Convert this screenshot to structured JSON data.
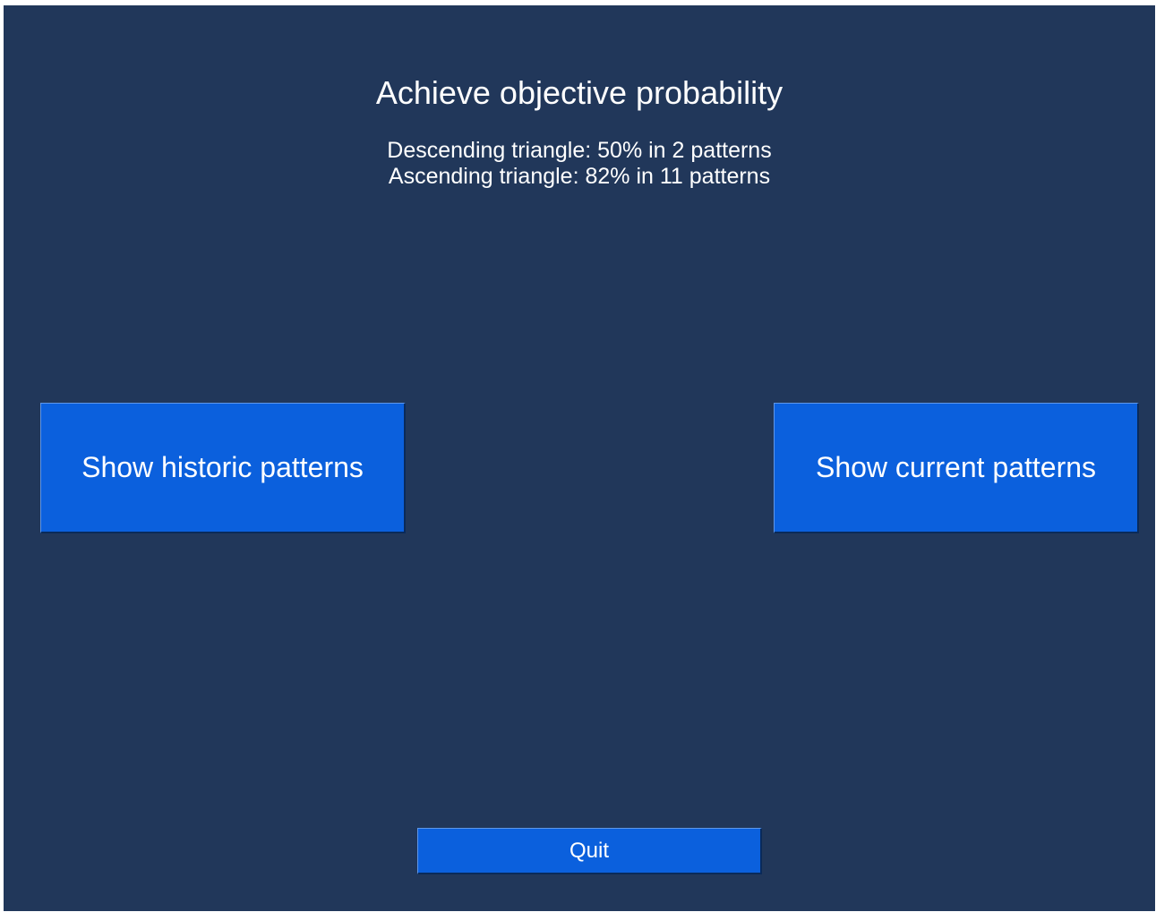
{
  "header": {
    "title": "Achieve objective probability"
  },
  "stats": [
    "Descending triangle: 50% in 2 patterns",
    "Ascending triangle: 82% in 11 patterns"
  ],
  "buttons": {
    "historic_label": "Show historic patterns",
    "current_label": "Show current patterns",
    "quit_label": "Quit"
  },
  "colors": {
    "background": "#21375a",
    "button": "#0b60dd",
    "text": "#ffffff"
  }
}
